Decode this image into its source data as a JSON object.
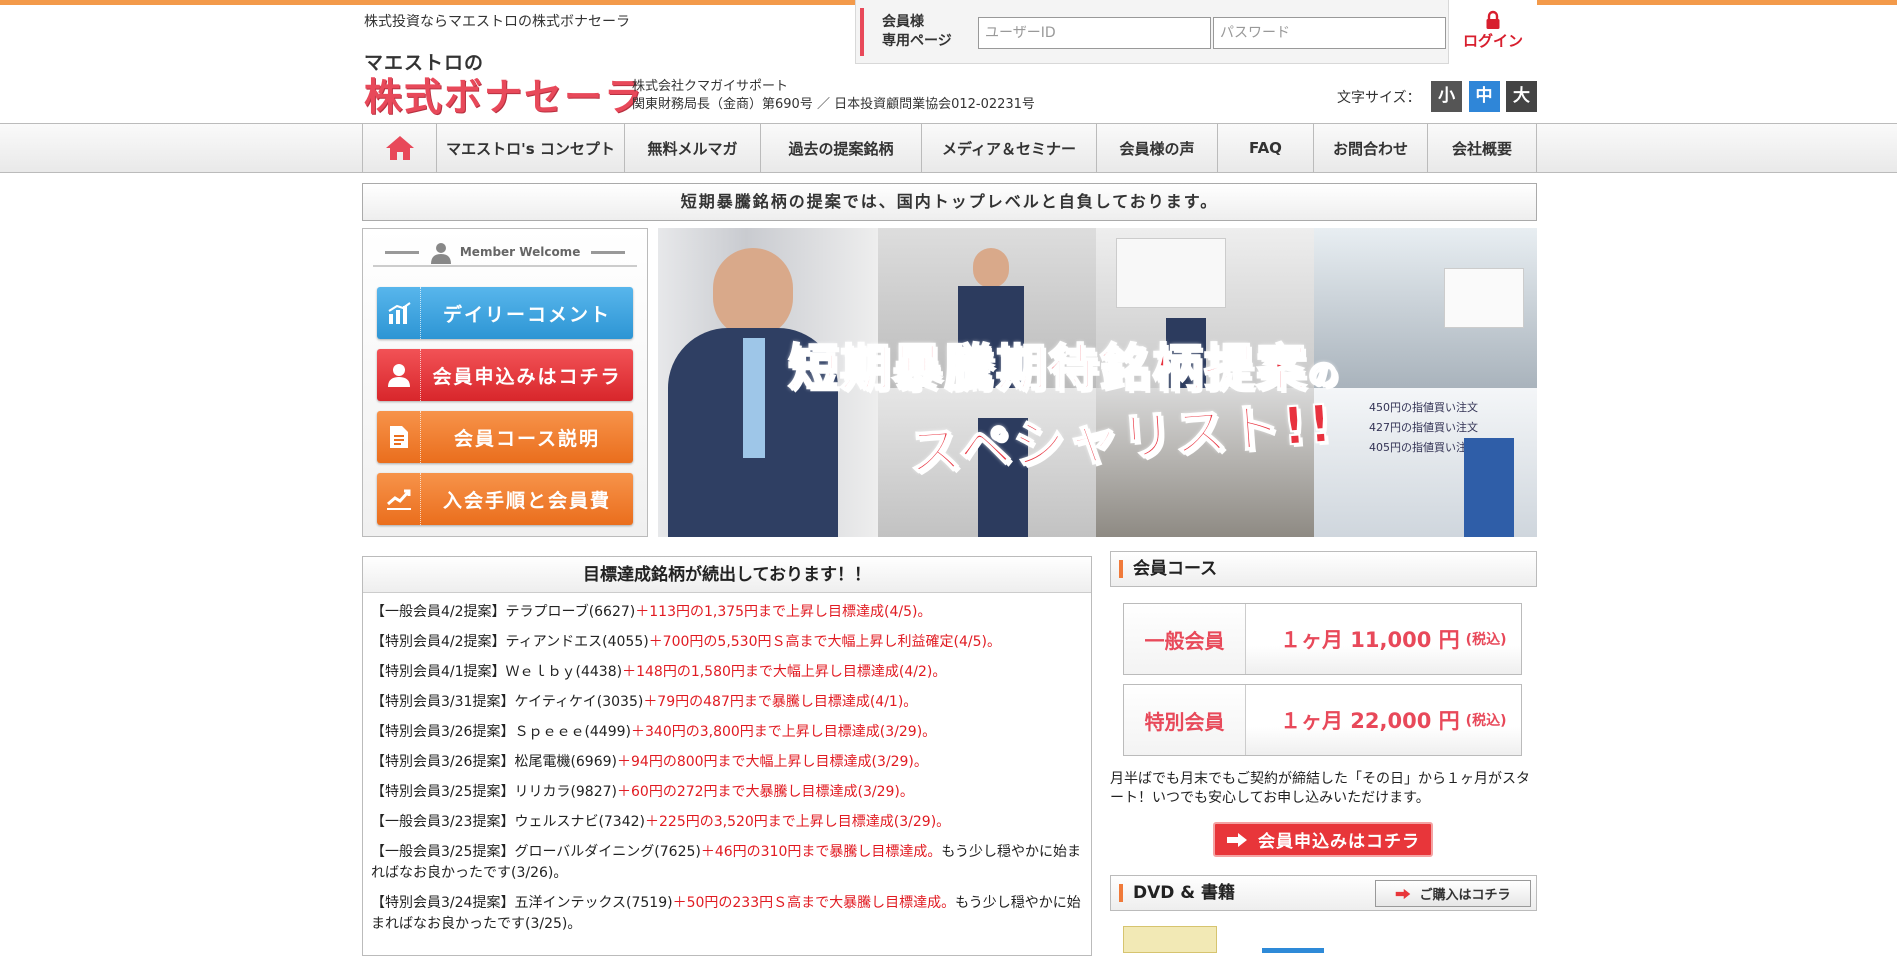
{
  "header": {
    "tagline": "株式投資ならマエストロの株式ボナセーラ",
    "logo_small": "マエストロの",
    "logo_big": "株式ボナセーラ",
    "company_name": "株式会社クマガイサポート",
    "company_reg": "関東財務局長（金商）第690号 ／ 日本投資顧問業協会012-02231号"
  },
  "login": {
    "label_line1": "会員様",
    "label_line2": "専用ページ",
    "user_placeholder": "ユーザーID",
    "pass_placeholder": "パスワード",
    "button": "ログイン",
    "icon": "lock-icon"
  },
  "font_size": {
    "label": "文字サイズ：",
    "small": "小",
    "medium": "中",
    "large": "大",
    "colors": {
      "small": "#555555",
      "medium": "#2f86d8",
      "large": "#444444"
    }
  },
  "nav": {
    "home_icon": "home-icon",
    "items": [
      "マエストロ's コンセプト",
      "無料メルマガ",
      "過去の提案銘柄",
      "メディア＆セミナー",
      "会員様の声",
      "FAQ",
      "お問合わせ",
      "会社概要"
    ]
  },
  "slogan": "短期暴騰銘柄の提案では、国内トップレベルと自負しております。",
  "member_panel": {
    "title": "Member Welcome",
    "buttons": [
      {
        "label": "デイリーコメント",
        "icon": "chart-icon",
        "color": "#3aa2dd"
      },
      {
        "label": "会員申込みはコチラ",
        "icon": "person-icon",
        "color": "#e8363a"
      },
      {
        "label": "会員コース説明",
        "icon": "document-icon",
        "color": "#f07a2a"
      },
      {
        "label": "入会手順と会員費",
        "icon": "growth-chart-icon",
        "color": "#f07a2a"
      }
    ]
  },
  "hero": {
    "line1_a": "短期暴騰期待",
    "line1_b": "銘柄提案",
    "line1_c": "の",
    "line2": "スペシャリスト!!",
    "board_lines": [
      "450円の指値買い注文",
      "427円の指値買い注文",
      "405円の指値買い注文"
    ]
  },
  "results": {
    "title": "目標達成銘柄が続出しております！！",
    "items": [
      {
        "prefix": "【一般会員4/2提案】テラプローブ(6627)",
        "highlight": "＋113円の1,375円まで上昇し目標達成(4/5)。",
        "suffix": ""
      },
      {
        "prefix": "【特別会員4/2提案】ティアンドエス(4055)",
        "highlight": "＋700円の5,530円Ｓ高まで大幅上昇し利益確定(4/5)。",
        "suffix": ""
      },
      {
        "prefix": "【特別会員4/1提案】Ｗｅｌｂｙ(4438)",
        "highlight": "＋148円の1,580円まで大幅上昇し目標達成(4/2)。",
        "suffix": ""
      },
      {
        "prefix": "【特別会員3/31提案】ケイティケイ(3035)",
        "highlight": "＋79円の487円まで暴騰し目標達成(4/1)。",
        "suffix": ""
      },
      {
        "prefix": "【特別会員3/26提案】Ｓｐｅｅｅ(4499)",
        "highlight": "＋340円の3,800円まで上昇し目標達成(3/29)。",
        "suffix": ""
      },
      {
        "prefix": "【特別会員3/26提案】松尾電機(6969)",
        "highlight": "＋94円の800円まで大幅上昇し目標達成(3/29)。",
        "suffix": ""
      },
      {
        "prefix": "【特別会員3/25提案】リリカラ(9827)",
        "highlight": "＋60円の272円まで大暴騰し目標達成(3/29)。",
        "suffix": ""
      },
      {
        "prefix": "【一般会員3/23提案】ウェルスナビ(7342)",
        "highlight": "＋225円の3,520円まで上昇し目標達成(3/29)。",
        "suffix": ""
      },
      {
        "prefix": "【一般会員3/25提案】グローバルダイニング(7625)",
        "highlight": "＋46円の310円まで暴騰し目標達成。",
        "suffix": "もう少し穏やかに始まればなお良かったです(3/26)。"
      },
      {
        "prefix": "【特別会員3/24提案】五洋インテックス(7519)",
        "highlight": "＋50円の233円Ｓ高まで大暴騰し目標達成。",
        "suffix": "もう少し穏やかに始まればなお良かったです(3/25)。"
      }
    ]
  },
  "courses": {
    "title": "会員コース",
    "items": [
      {
        "name": "一般会員",
        "price": "１ヶ月 11,000 円",
        "tax": "(税込)"
      },
      {
        "name": "特別会員",
        "price": "１ヶ月 22,000 円",
        "tax": "(税込)"
      }
    ],
    "note": "月半ばでも月末でもご契約が締結した「その日」から１ヶ月がスタート！いつでも安心してお申し込みいただけます。",
    "apply_button": "会員申込みはコチラ"
  },
  "dvd": {
    "title": "DVD & 書籍",
    "buy_button": "ご購入はコチラ"
  },
  "colors": {
    "accent": "#e8495a",
    "orange": "#f39a4a",
    "red": "#e11b22"
  }
}
